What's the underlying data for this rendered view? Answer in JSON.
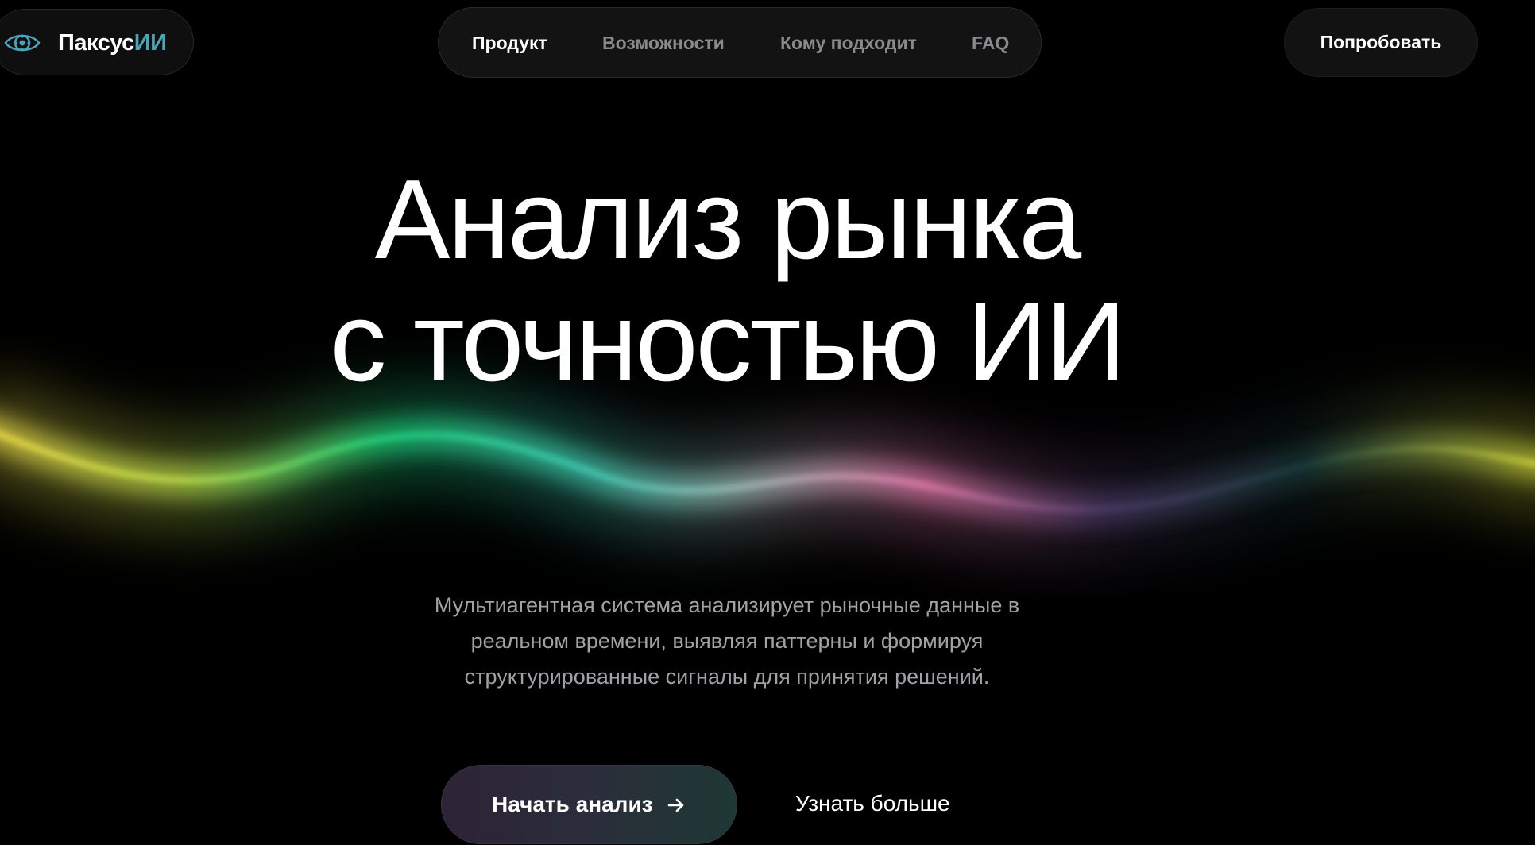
{
  "header": {
    "logo": {
      "text": "Паксус",
      "accent": "ИИ",
      "icon": "eye-icon"
    },
    "nav": [
      {
        "label": "Продукт",
        "active": true
      },
      {
        "label": "Возможности",
        "active": false
      },
      {
        "label": "Кому подходит",
        "active": false
      },
      {
        "label": "FAQ",
        "active": false
      }
    ],
    "cta_label": "Попробовать"
  },
  "hero": {
    "title_line1": "Анализ рынка",
    "title_line2": "с точностью ИИ",
    "subtitle_line1": "Мультиагентная система анализирует рыночные данные в",
    "subtitle_line2": "реальном времени, выявляя паттерны и формируя",
    "subtitle_line3": "структурированные сигналы для принятия решений.",
    "primary_label": "Начать анализ",
    "primary_icon": "arrow-right-icon",
    "secondary_label": "Узнать больше"
  },
  "colors": {
    "background": "#000000",
    "logo_accent": "#4aa3b6",
    "nav_muted": "#8a8a8e",
    "subtitle": "#a2a2a6",
    "wave_yellow": "#e8d94a",
    "wave_green": "#1fd07a",
    "wave_teal": "#3fc9b0",
    "wave_pink": "#e27aa8"
  }
}
